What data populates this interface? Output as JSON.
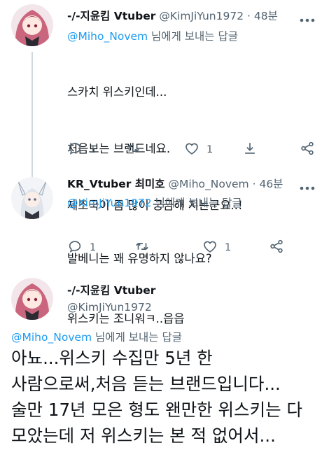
{
  "tweets": [
    {
      "name": "-/-지윤킴 Vtuber",
      "handle": "@KimJiYun1972",
      "separator": "·",
      "time": "48분",
      "reply_to": "@Miho_Novem",
      "reply_suffix": " 님에게 보내는 답글",
      "lines": [
        "스카치 위스키인데...",
        "처음보는 브랜드네요.",
        "제조국이 좀 많이 궁금해 지는군요..!",
        "",
        "위스키는 조니워ㅋ..읍읍"
      ],
      "reply_count": "1",
      "like_count": "1"
    },
    {
      "name": "KR_Vtuber 최미호",
      "handle": "@Miho_Novem",
      "separator": "·",
      "time": "46분",
      "reply_to": "@KimJiYun1972",
      "reply_suffix": " 님에게 보내는 답글",
      "lines": [
        "발베니는 꽤 유명하지 않나요?"
      ],
      "reply_count": "1",
      "like_count": "1"
    },
    {
      "name": "-/-지윤킴 Vtuber",
      "handle": "@KimJiYun1972",
      "reply_to": "@Miho_Novem",
      "reply_suffix": " 님에게 보내는 답글",
      "lines": [
        "아뇨...위스키 수집만 5년 한",
        "사람으로써,처음 듣는 브랜드입니다...",
        "술만 17년 모은 형도 왠만한 위스키는 다",
        "모았는데 저 위스키는 본 적 없어서..."
      ]
    }
  ],
  "colors": {
    "accent": "#1d9bf0",
    "muted": "#536471",
    "text": "#0f1419",
    "line": "#cfd9de"
  }
}
